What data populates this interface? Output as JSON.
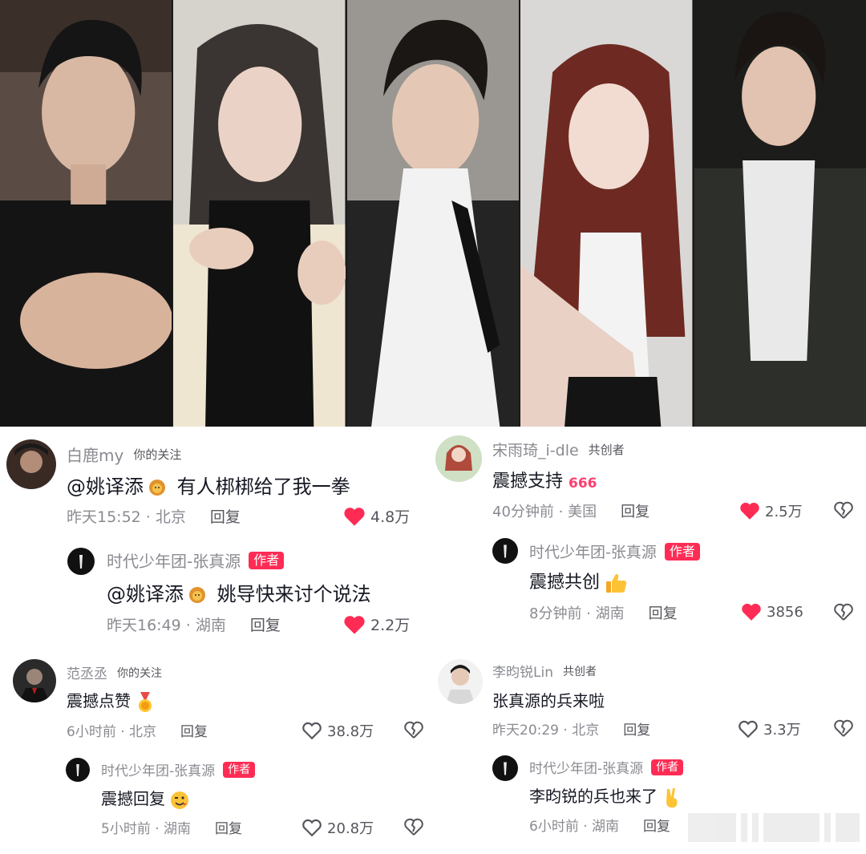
{
  "colors": {
    "accent": "#fe2c55",
    "meta": "#8a8b91",
    "text": "#161823"
  },
  "photos": [
    "photo-1",
    "photo-2",
    "photo-3",
    "photo-4",
    "photo-5"
  ],
  "comments": {
    "c1": {
      "username": "白鹿my",
      "tag": "你的关注",
      "mention": "@姚译添",
      "text": "有人梆梆给了我一拳",
      "time": "昨天15:52 · 北京",
      "reply": "回复",
      "likes": "4.8万",
      "liked": true,
      "reply_item": {
        "username": "时代少年团-张真源",
        "badge": "作者",
        "mention": "@姚译添",
        "text": "姚导快来讨个说法",
        "time": "昨天16:49 · 湖南",
        "reply": "回复",
        "likes": "2.2万",
        "liked": true
      }
    },
    "c2": {
      "username": "宋雨琦_i-dle",
      "tag": "共创者",
      "text": "震撼支持",
      "emoji": "666",
      "time": "40分钟前 · 美国",
      "reply": "回复",
      "likes": "2.5万",
      "liked": true,
      "reply_item": {
        "username": "时代少年团-张真源",
        "badge": "作者",
        "text": "震撼共创",
        "emoji": "thumbs-up",
        "time": "8分钟前 · 湖南",
        "reply": "回复",
        "likes": "3856",
        "liked": true
      }
    },
    "c3": {
      "username": "范丞丞",
      "tag": "你的关注",
      "text": "震撼点赞",
      "emoji": "medal",
      "time": "6小时前 · 北京",
      "reply": "回复",
      "likes": "38.8万",
      "liked": false,
      "reply_item": {
        "username": "时代少年团-张真源",
        "badge": "作者",
        "text": "震撼回复",
        "emoji": "wink",
        "time": "5小时前 · 湖南",
        "reply": "回复",
        "likes": "20.8万",
        "liked": false
      }
    },
    "c4": {
      "username": "李昀锐Lin",
      "tag": "共创者",
      "text": "张真源的兵来啦",
      "time": "昨天20:29 · 北京",
      "reply": "回复",
      "likes": "3.3万",
      "liked": false,
      "reply_item": {
        "username": "时代少年团-张真源",
        "badge": "作者",
        "text": "李昀锐的兵也来了",
        "emoji": "victory",
        "time": "6小时前 · 湖南",
        "reply": "回复"
      }
    }
  }
}
